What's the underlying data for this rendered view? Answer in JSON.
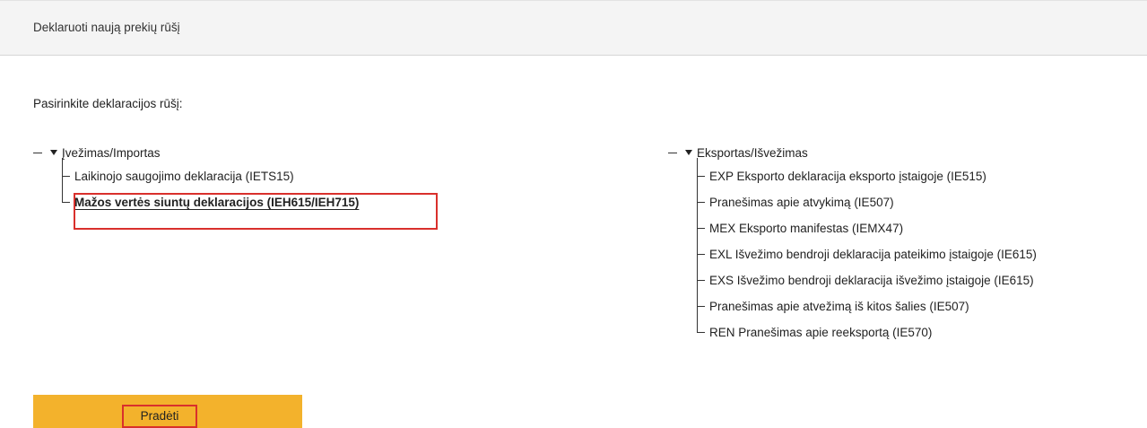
{
  "header": {
    "title": "Deklaruoti naują prekių rūšį"
  },
  "prompt": "Pasirinkite deklaracijos rūšį:",
  "import_tree": {
    "root_label": "Įvežimas/Importas",
    "items": [
      "Laikinojo saugojimo deklaracija (IETS15)",
      "Mažos vertės siuntų deklaracijos (IEH615/IEH715)"
    ],
    "selected_index": 1
  },
  "export_tree": {
    "root_label": "Eksportas/Išvežimas",
    "items": [
      "EXP Eksporto deklaracija eksporto įstaigoje (IE515)",
      "Pranešimas apie atvykimą (IE507)",
      "MEX Eksporto manifestas (IEMX47)",
      "EXL Išvežimo bendroji deklaracija pateikimo įstaigoje (IE615)",
      "EXS Išvežimo bendroji deklaracija išvežimo įstaigoje (IE615)",
      "Pranešimas apie atvežimą iš kitos šalies (IE507)",
      "REN Pranešimas apie reeksportą (IE570)"
    ]
  },
  "actions": {
    "start_label": "Pradėti"
  },
  "colors": {
    "accent": "#f3b22c",
    "highlight": "#d9302c",
    "header_bg": "#f4f4f4"
  }
}
